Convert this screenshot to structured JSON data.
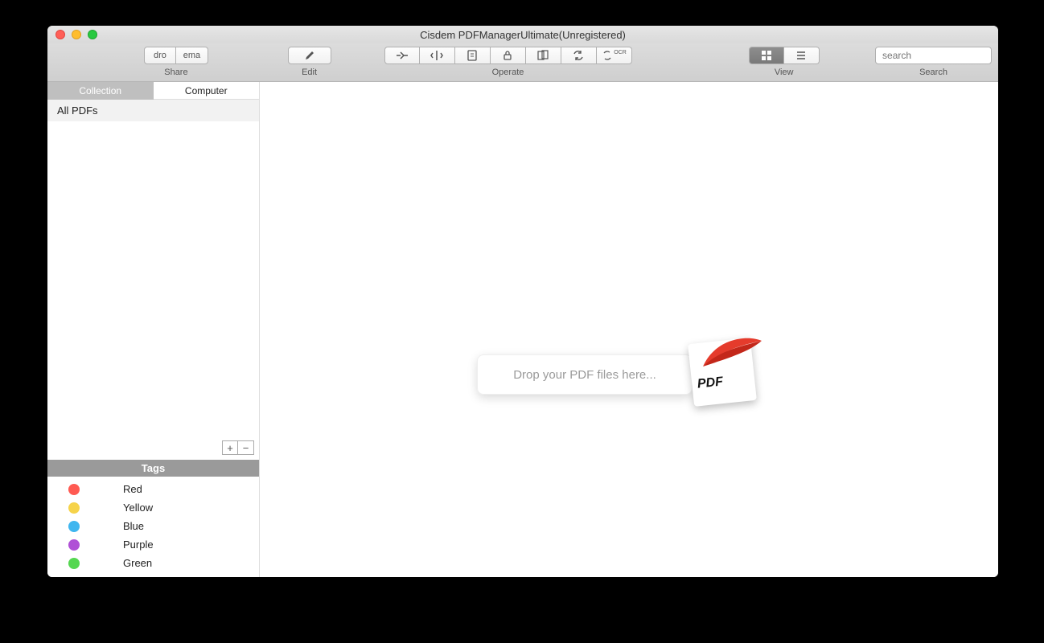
{
  "window": {
    "title": "Cisdem PDFManagerUltimate(Unregistered)"
  },
  "toolbar": {
    "share": {
      "label": "Share",
      "btn1": "dro",
      "btn2": "ema"
    },
    "edit": {
      "label": "Edit"
    },
    "operate": {
      "label": "Operate"
    },
    "view": {
      "label": "View"
    },
    "search": {
      "label": "Search",
      "placeholder": "search"
    }
  },
  "sidebar": {
    "tabs": {
      "collection": "Collection",
      "computer": "Computer"
    },
    "all_pdfs": "All PDFs",
    "tags_header": "Tags",
    "tags": [
      {
        "label": "Red",
        "color": "#ff5a52"
      },
      {
        "label": "Yellow",
        "color": "#f6d34a"
      },
      {
        "label": "Blue",
        "color": "#3fb6ef"
      },
      {
        "label": "Purple",
        "color": "#b050d6"
      },
      {
        "label": "Green",
        "color": "#55d751"
      }
    ]
  },
  "main": {
    "drop_hint": "Drop your PDF files here...",
    "pdf_badge": "PDF"
  }
}
